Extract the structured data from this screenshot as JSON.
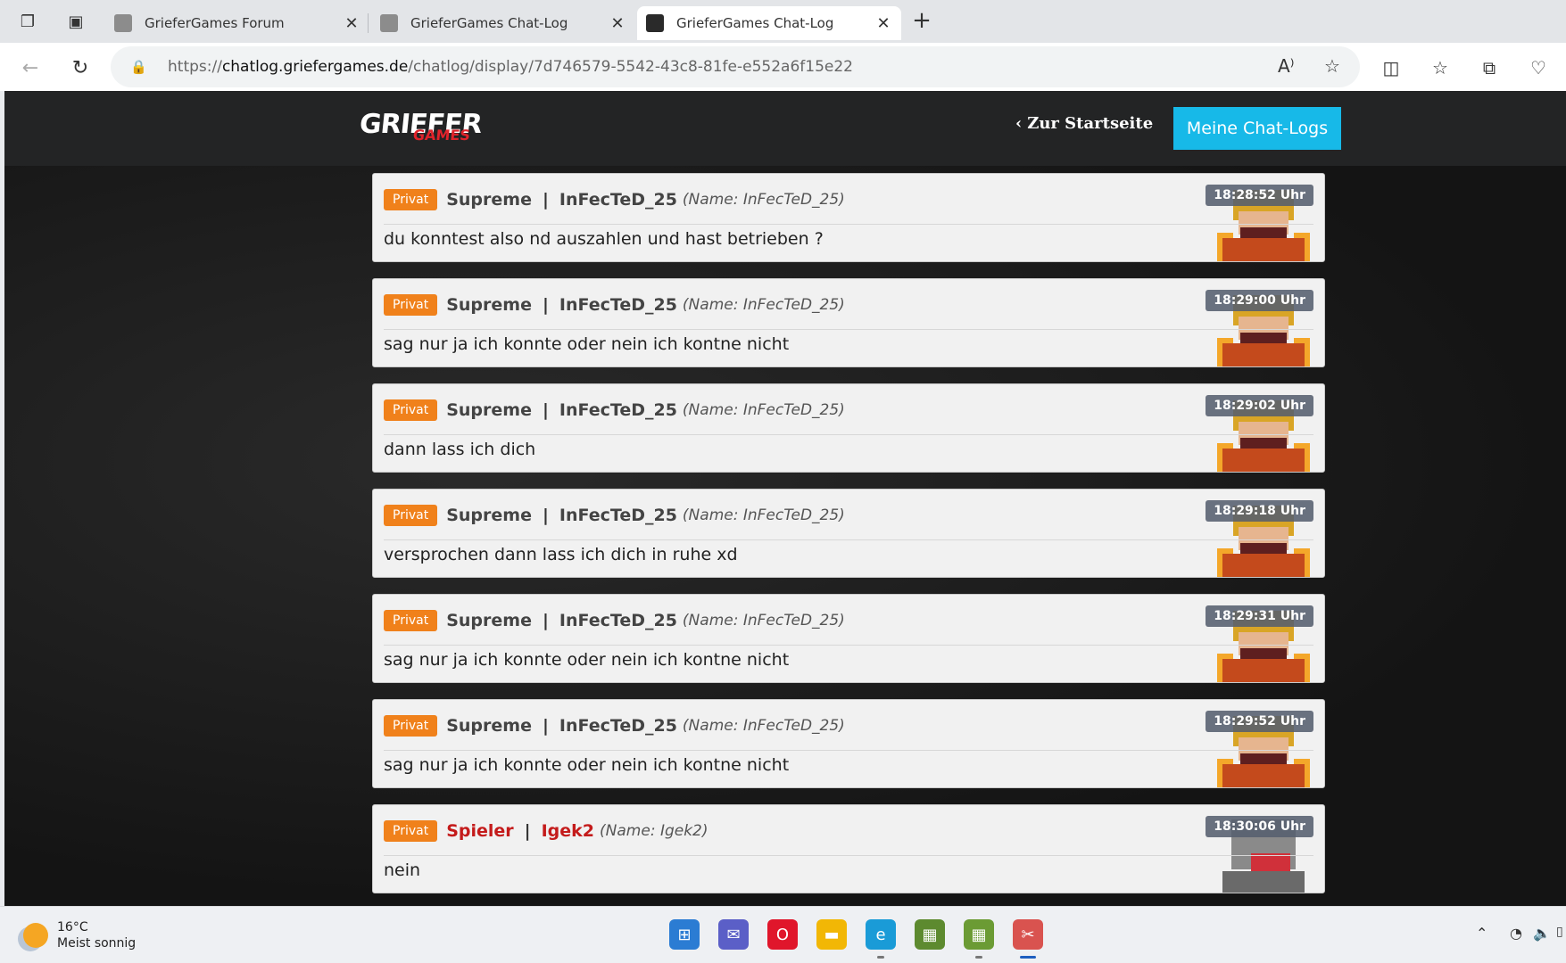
{
  "browser": {
    "tabs": [
      {
        "title": "GrieferGames Forum",
        "active": false
      },
      {
        "title": "GrieferGames Chat-Log",
        "active": false
      },
      {
        "title": "GrieferGames Chat-Log",
        "active": true
      }
    ],
    "url_prefix": "https://",
    "url_domain": "chatlog.griefergames.de",
    "url_path": "/chatlog/display/7d746579-5542-43c8-81fe-e552a6f15e22"
  },
  "site": {
    "logo_main": "GRIEFER",
    "logo_sub": "GAMES",
    "home_link": "Zur Startseite",
    "my_logs_button": "Meine Chat-Logs"
  },
  "messages": [
    {
      "badge": "Privat",
      "rank": "Supreme",
      "separator": "|",
      "player": "InFecTeD_25",
      "realname": "(Name: InFecTeD_25)",
      "text": "du konntest also nd auszahlen und hast betrieben ?",
      "time": "18:28:52 Uhr",
      "rank_color": "#444444",
      "skin": "fire"
    },
    {
      "badge": "Privat",
      "rank": "Supreme",
      "separator": "|",
      "player": "InFecTeD_25",
      "realname": "(Name: InFecTeD_25)",
      "text": "sag nur ja ich konnte oder nein ich kontne nicht",
      "time": "18:29:00 Uhr",
      "rank_color": "#444444",
      "skin": "fire"
    },
    {
      "badge": "Privat",
      "rank": "Supreme",
      "separator": "|",
      "player": "InFecTeD_25",
      "realname": "(Name: InFecTeD_25)",
      "text": "dann lass ich dich",
      "time": "18:29:02 Uhr",
      "rank_color": "#444444",
      "skin": "fire"
    },
    {
      "badge": "Privat",
      "rank": "Supreme",
      "separator": "|",
      "player": "InFecTeD_25",
      "realname": "(Name: InFecTeD_25)",
      "text": "versprochen dann lass ich dich in ruhe xd",
      "time": "18:29:18 Uhr",
      "rank_color": "#444444",
      "skin": "fire"
    },
    {
      "badge": "Privat",
      "rank": "Supreme",
      "separator": "|",
      "player": "InFecTeD_25",
      "realname": "(Name: InFecTeD_25)",
      "text": "sag nur ja ich konnte oder nein ich kontne nicht",
      "time": "18:29:31 Uhr",
      "rank_color": "#444444",
      "skin": "fire"
    },
    {
      "badge": "Privat",
      "rank": "Supreme",
      "separator": "|",
      "player": "InFecTeD_25",
      "realname": "(Name: InFecTeD_25)",
      "text": "sag nur ja ich konnte oder nein ich kontne nicht",
      "time": "18:29:52 Uhr",
      "rank_color": "#444444",
      "skin": "fire"
    },
    {
      "badge": "Privat",
      "rank": "Spieler",
      "separator": "|",
      "player": "Igek2",
      "realname": "(Name: Igek2)",
      "text": "nein",
      "time": "18:30:06 Uhr",
      "rank_color": "#c41b1b",
      "skin": "mask"
    }
  ],
  "taskbar": {
    "temperature": "16°C",
    "weather": "Meist sonnig",
    "apps": [
      {
        "name": "windows-start",
        "color": "#2b7cd3",
        "active": false,
        "running": false
      },
      {
        "name": "teams",
        "color": "#5b5fc7",
        "active": false,
        "running": false
      },
      {
        "name": "opera",
        "color": "#e0162b",
        "active": false,
        "running": false
      },
      {
        "name": "file-explorer",
        "color": "#f2b705",
        "active": false,
        "running": false
      },
      {
        "name": "edge",
        "color": "#1a9bd7",
        "active": false,
        "running": true
      },
      {
        "name": "minecraft",
        "color": "#5d8a2f",
        "active": false,
        "running": false
      },
      {
        "name": "minecraft-launcher",
        "color": "#6b9b34",
        "active": false,
        "running": true
      },
      {
        "name": "snipping-tool",
        "color": "#d9534f",
        "active": true,
        "running": true
      }
    ]
  }
}
